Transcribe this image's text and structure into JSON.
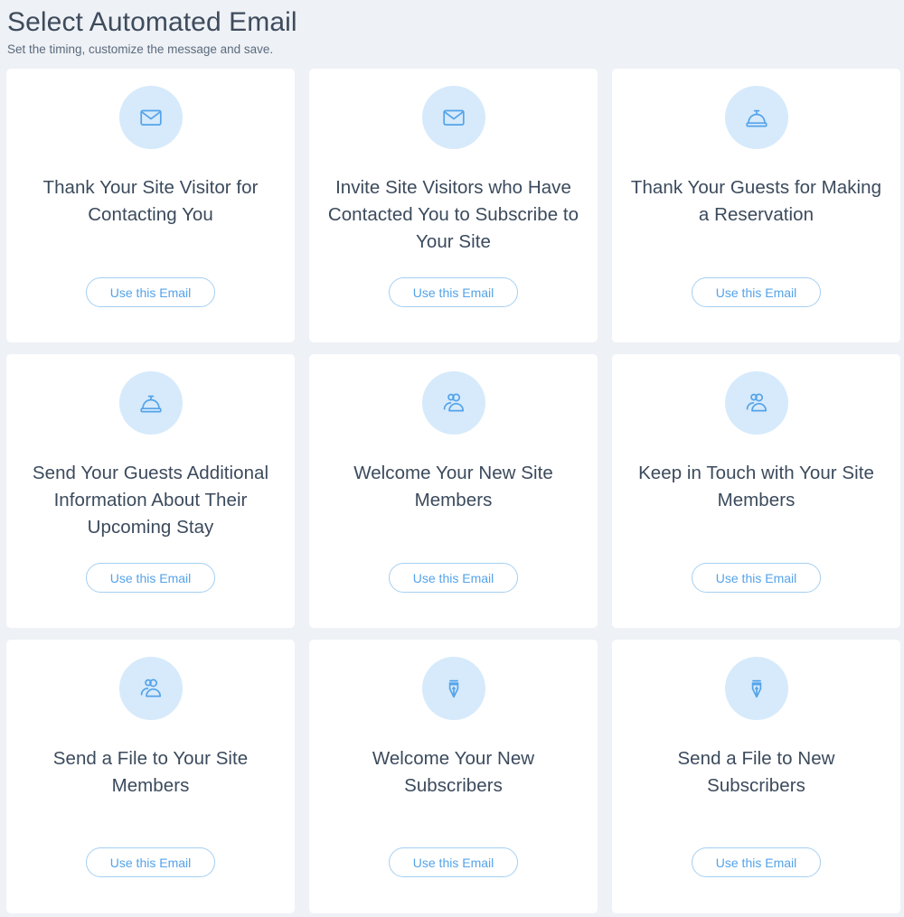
{
  "header": {
    "title": "Select Automated Email",
    "subtitle": "Set the timing, customize the message and save."
  },
  "colors": {
    "page_background": "#eef1f5",
    "card_background": "#ffffff",
    "icon_circle": "#d6eafb",
    "icon_stroke": "#54a3ea",
    "title_text": "#3b4a5c",
    "header_text": "#3d4b5c",
    "subtitle_text": "#5b6b7d",
    "button_border": "#a5cff1",
    "button_text": "#54a3ea"
  },
  "button_label": "Use this Email",
  "cards": [
    {
      "title": "Thank Your Site Visitor for Contacting You",
      "icon": "envelope-icon",
      "button_label": "Use this Email",
      "row": 1,
      "column": 1
    },
    {
      "title": "Invite Site Visitors who Have Contacted You to Subscribe to Your Site",
      "icon": "envelope-icon",
      "button_label": "Use this Email",
      "row": 1,
      "column": 2
    },
    {
      "title": "Thank Your Guests for Making a Reservation",
      "icon": "service-bell-icon",
      "button_label": "Use this Email",
      "row": 1,
      "column": 3
    },
    {
      "title": "Send Your Guests Additional Information About Their Upcoming Stay",
      "icon": "service-bell-icon",
      "button_label": "Use this Email",
      "row": 2,
      "column": 1
    },
    {
      "title": "Welcome Your New Site Members",
      "icon": "members-icon",
      "button_label": "Use this Email",
      "row": 2,
      "column": 2
    },
    {
      "title": "Keep in Touch with Your Site Members",
      "icon": "members-icon",
      "button_label": "Use this Email",
      "row": 2,
      "column": 3
    },
    {
      "title": "Send a File to Your Site Members",
      "icon": "members-icon",
      "button_label": "Use this Email",
      "row": 3,
      "column": 1
    },
    {
      "title": "Welcome Your New Subscribers",
      "icon": "pen-nib-icon",
      "button_label": "Use this Email",
      "row": 3,
      "column": 2
    },
    {
      "title": "Send a File to New Subscribers",
      "icon": "pen-nib-icon",
      "button_label": "Use this Email",
      "row": 3,
      "column": 3
    }
  ]
}
